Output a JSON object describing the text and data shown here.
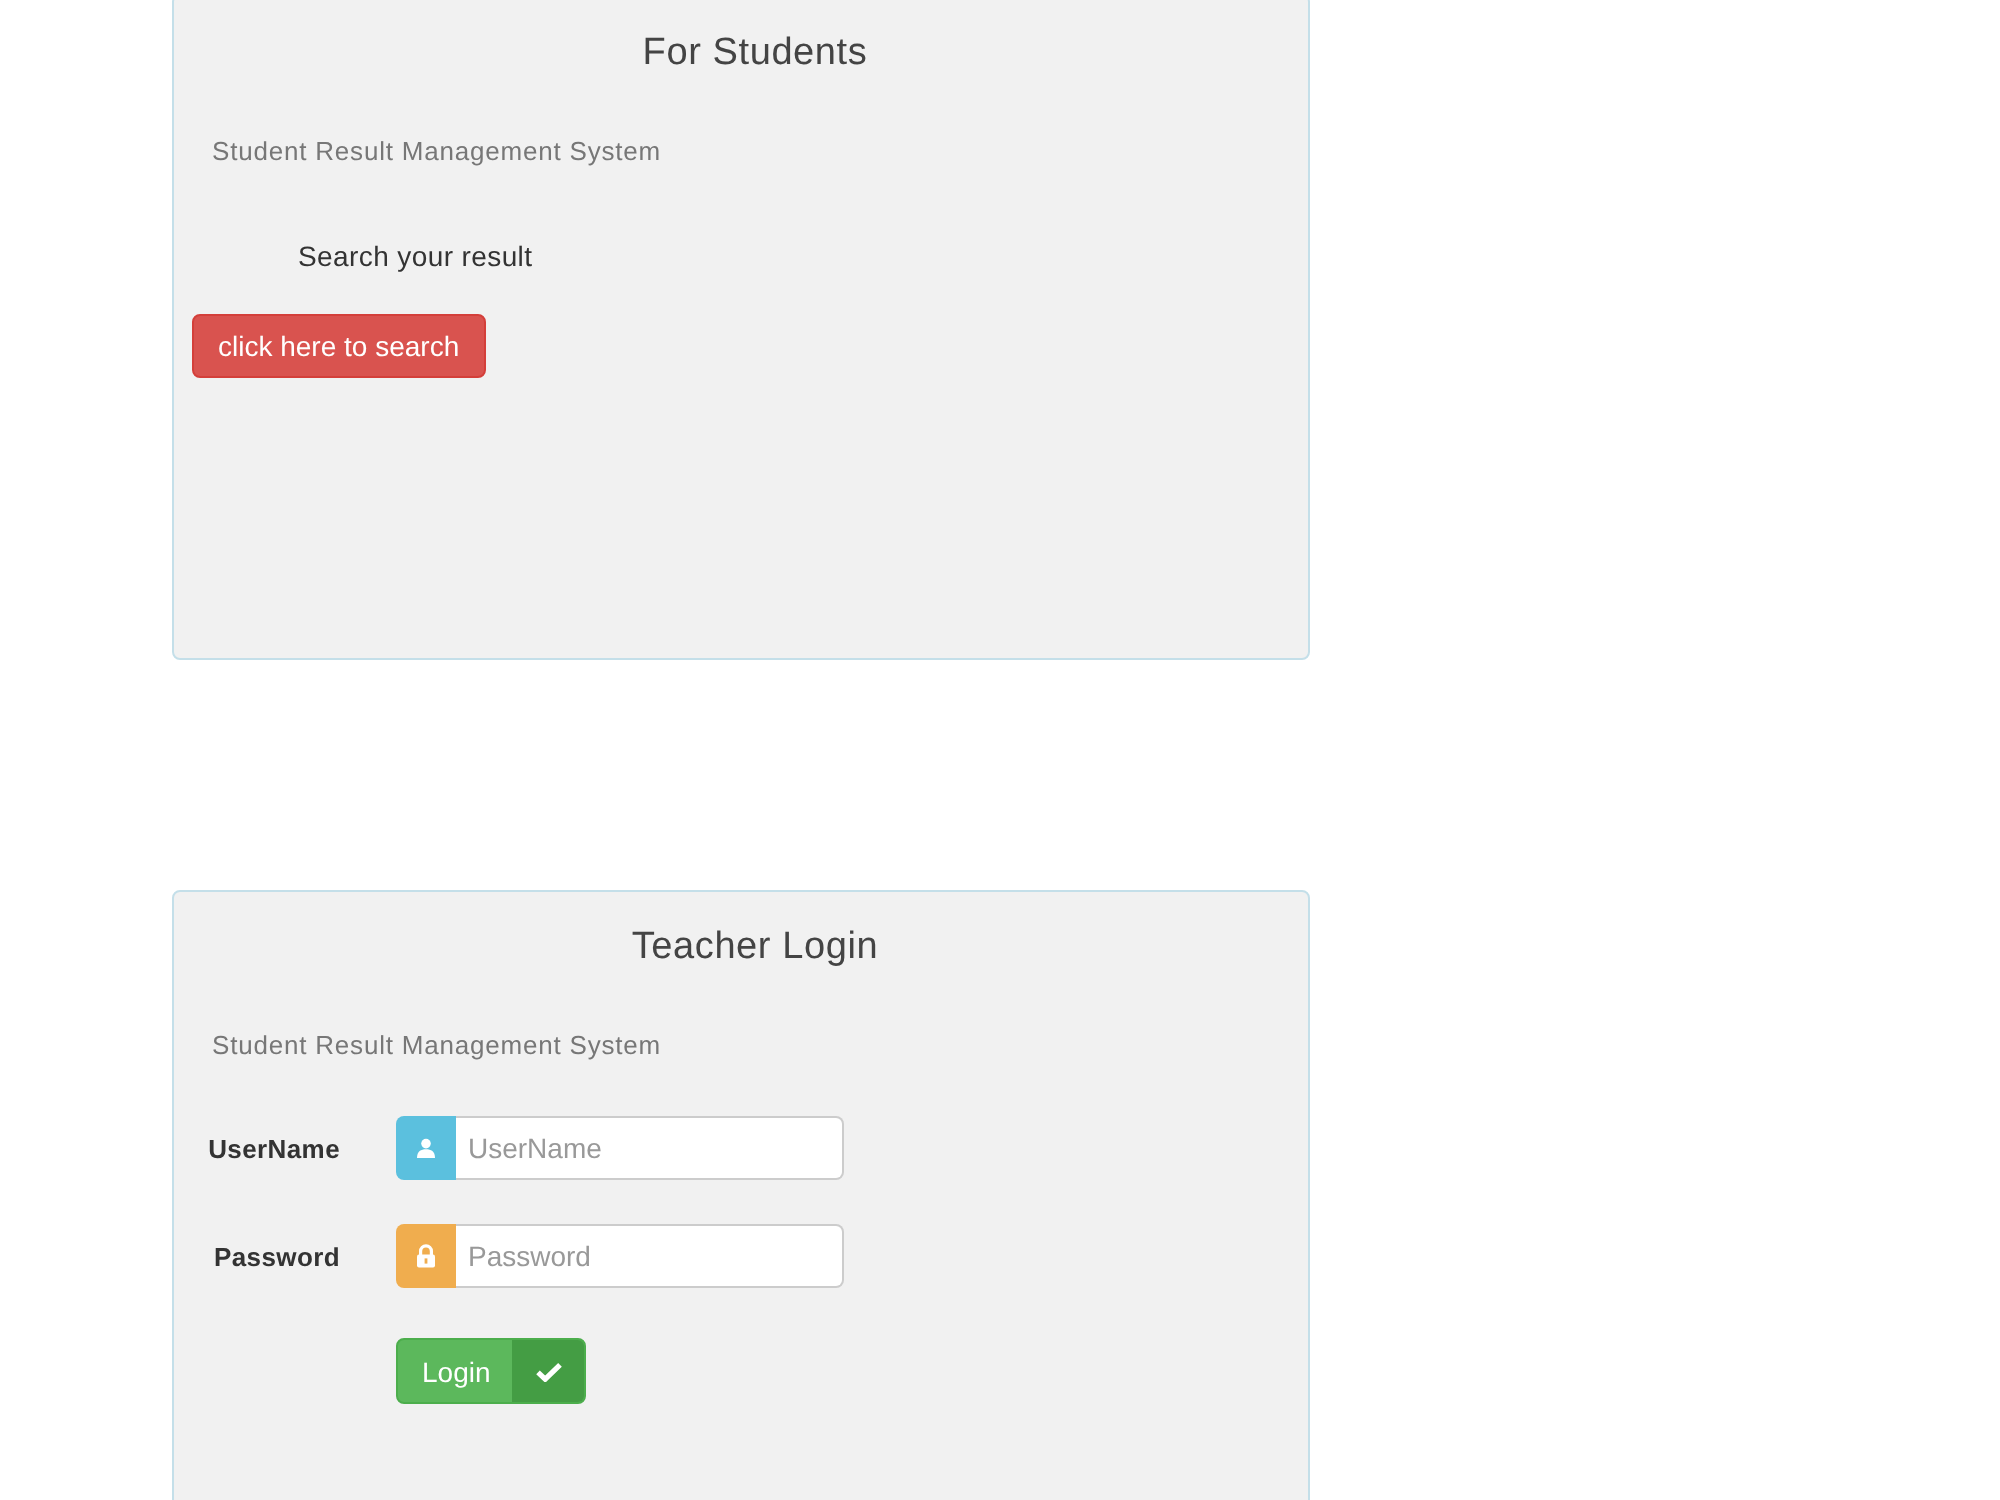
{
  "panels": [
    {
      "kind": "search",
      "title": "For Students",
      "subtitle": "Student Result Management System",
      "prompt": "Search your result",
      "button": {
        "label": "click here to search"
      }
    },
    {
      "kind": "login",
      "title": "Teacher Login",
      "subtitle": "Student Result Management System",
      "fields": [
        {
          "kind": "text",
          "label": "UserName",
          "color": "#5bc0de",
          "placeholder": "UserName"
        },
        {
          "kind": "password",
          "label": "Password",
          "color": "#f0ad4e",
          "placeholder": "Password"
        }
      ],
      "button": {
        "label": "Login"
      }
    }
  ]
}
